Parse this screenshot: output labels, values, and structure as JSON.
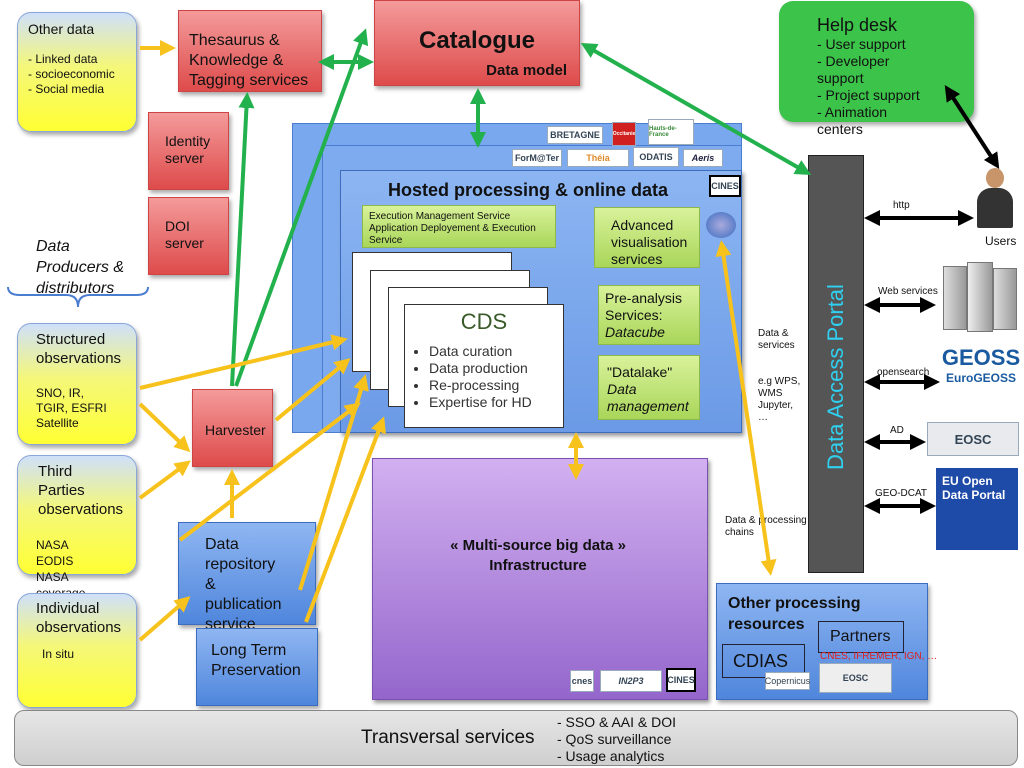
{
  "other_data": {
    "title": "Other data",
    "items": [
      "- Linked data",
      "- socioeconomic",
      "- Social media"
    ]
  },
  "thesaurus": "Thesaurus & Knowledge & Tagging services",
  "catalogue": {
    "title": "Catalogue",
    "subtitle": "Data model"
  },
  "helpdesk": {
    "title": "Help desk",
    "items": [
      "- User support",
      "- Developer support",
      "- Project support",
      "- Animation centers"
    ]
  },
  "identity": "Identity server",
  "doi": "DOI server",
  "producers": "Data Producers & distributors",
  "structured": {
    "title": "Structured observations",
    "detail": "SNO, IR, TGIR, ESFRI Satellite"
  },
  "third": {
    "title": "Third Parties observations",
    "detail": "NASA EODIS NASA coverage Copernicus"
  },
  "individual": {
    "title": "Individual observations",
    "detail": "In situ"
  },
  "harvester": "Harvester",
  "repository": "Data repository & publication service",
  "ltp": "Long Term Preservation",
  "hosted": {
    "title": "Hosted processing & online data",
    "exec": "Execution Management Service Application Deployement & Execution Service",
    "advanced": "Advanced visualisation services",
    "preanalysis": "Pre-analysis Services:",
    "datacube": "Datacube",
    "datalake": "\"Datalake\"",
    "datamgmt": "Data management"
  },
  "cds": {
    "title": "CDS",
    "items": [
      "Data curation",
      "Data production",
      "Re-processing",
      "Expertise for HD"
    ]
  },
  "logos": [
    "BRETAGNE",
    "Occitanie",
    "Hauts-de-France",
    "ForM@Ter",
    "Théia",
    "ODATIS",
    "Aeris",
    "CINES",
    "IN2P3",
    "cnes",
    "Copernicus",
    "EOSC"
  ],
  "multisource": "« Multi-source big data » Infrastructure",
  "other_proc": {
    "title": "Other processing resources",
    "partners": "Partners",
    "partners_list": "CNES, IFREMER, IGN, …",
    "cdias": "CDIAS"
  },
  "portal": "Data Access Portal",
  "labels": {
    "data_services": "Data & services",
    "eg": "e.g WPS, WMS Jupyter, …",
    "data_chains": "Data & processing chains",
    "http": "http",
    "users": "Users",
    "web_services": "Web services",
    "opensearch": "opensearch",
    "ad": "AD",
    "geodcat": "GEO-DCAT"
  },
  "external": {
    "geoss": "GEOSS",
    "eurogeoss": "EuroGEOSS",
    "eosc": "EOSC",
    "eu_portal": "EU Open Data Portal"
  },
  "transversal": {
    "title": "Transversal services",
    "items": [
      "- SSO & AAI  &  DOI",
      "- QoS surveillance",
      "- Usage analytics"
    ]
  },
  "colors": {
    "green_arrow": "#22b14c",
    "yellow_arrow": "#f7c21b",
    "portal": "#555555",
    "portal_text": "#2fd0f0"
  }
}
